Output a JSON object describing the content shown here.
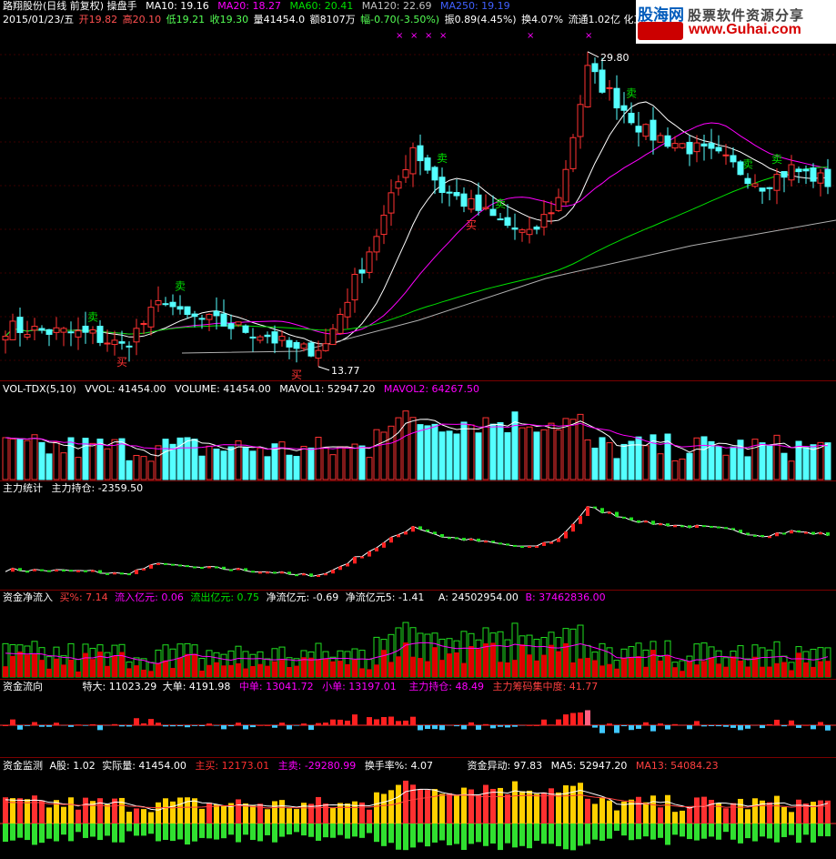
{
  "colors": {
    "up": "#ff3232",
    "down": "#54ffff",
    "ma10": "#ffffff",
    "ma20": "#ff00ff",
    "ma60": "#00e000",
    "ma120": "#b0b0b0",
    "ma250": "#4040ff",
    "border": "#7a0000",
    "bg": "#000000"
  },
  "header": {
    "title": "路翔股份(日线 前复权) 操盘手",
    "ma10": "MA10: 19.16",
    "ma20": "MA20: 18.27",
    "ma60": "MA60: 20.41",
    "ma120": "MA120: 22.69",
    "ma250": "MA250: 19.19"
  },
  "info_line": {
    "date": "2015/01/23/五",
    "open": "开19.82",
    "high": "高20.10",
    "low": "低19.21",
    "close": "收19.30",
    "volume": "量41454.0",
    "amount": "额8107万",
    "change": "幅-0.70(-3.50%)",
    "amplitude": "振0.89(4.45%)",
    "turnover": "换4.07%",
    "float": "流通1.02亿 化工原"
  },
  "price_labels": {
    "high": "29.80",
    "low": "13.77"
  },
  "signals": {
    "buy": "买",
    "sell": "卖"
  },
  "watermark": {
    "brand": "股海网",
    "tagline": "股票软件资源分享",
    "url": "www.Guhai.com"
  },
  "vol_panel": {
    "name": "VOL-TDX(5,10)",
    "vvol": "VVOL: 41454.00",
    "volume": "VOLUME: 41454.00",
    "mavol1": "MAVOL1: 52947.20",
    "mavol2": "MAVOL2: 64267.50"
  },
  "zl_panel": {
    "name": "主力统计",
    "hold": "主力持仓: -2359.50"
  },
  "jlr_panel": {
    "name": "资金净流入",
    "buy_pct": "买%: 7.14",
    "inflow": "流入亿元: 0.06",
    "outflow": "流出亿元: 0.75",
    "net": "净流亿元: -0.69",
    "net5": "净流亿元5: -1.41",
    "a": "A: 24502954.00",
    "b": "B: 37462836.00"
  },
  "flow_panel": {
    "name": "资金流向",
    "xl": "特大: 11023.29",
    "lg": "大单: 4191.98",
    "md": "中单: 13041.72",
    "sm": "小单: 13197.01",
    "hold": "主力持仓: 48.49",
    "conc": "主力筹码集中度: 41.77"
  },
  "mon_panel": {
    "name": "资金监测",
    "ashare": "A股: 1.02",
    "actual": "实际量: 41454.00",
    "buy": "主买: 12173.01",
    "sell": "主卖: -29280.99",
    "turn": "换手率%: 4.07",
    "abn": "资金异动: 97.83",
    "ma5": "MA5: 52947.20",
    "ma13": "MA13: 54084.23"
  }
}
